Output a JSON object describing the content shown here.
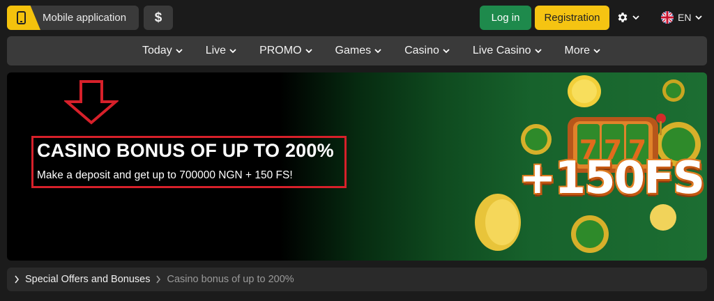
{
  "header": {
    "mobile_app_label": "Mobile application",
    "mobile_icon": "smartphone-icon",
    "currency_symbol": "$",
    "login_label": "Log in",
    "registration_label": "Registration",
    "settings_icon": "gear-icon",
    "language_code": "EN",
    "language_flag": "uk-flag-icon",
    "colors": {
      "login": "#1e8a4c",
      "registration": "#f5c412",
      "accent": "#f4c20d"
    }
  },
  "nav": {
    "items": [
      {
        "label": "Today"
      },
      {
        "label": "Live"
      },
      {
        "label": "PROMO"
      },
      {
        "label": "Games"
      },
      {
        "label": "Casino"
      },
      {
        "label": "Live Casino"
      },
      {
        "label": "More"
      }
    ]
  },
  "banner": {
    "title": "CASINO BONUS OF UP TO 200%",
    "subtitle": "Make a deposit and get up to 700000 NGN + 150 FS!",
    "graphic_text": "+150FS",
    "slot_digits": "777",
    "highlight_color": "#d7202a"
  },
  "breadcrumb": {
    "parent": "Special Offers and Bonuses",
    "current": "Casino bonus of up to 200%"
  }
}
